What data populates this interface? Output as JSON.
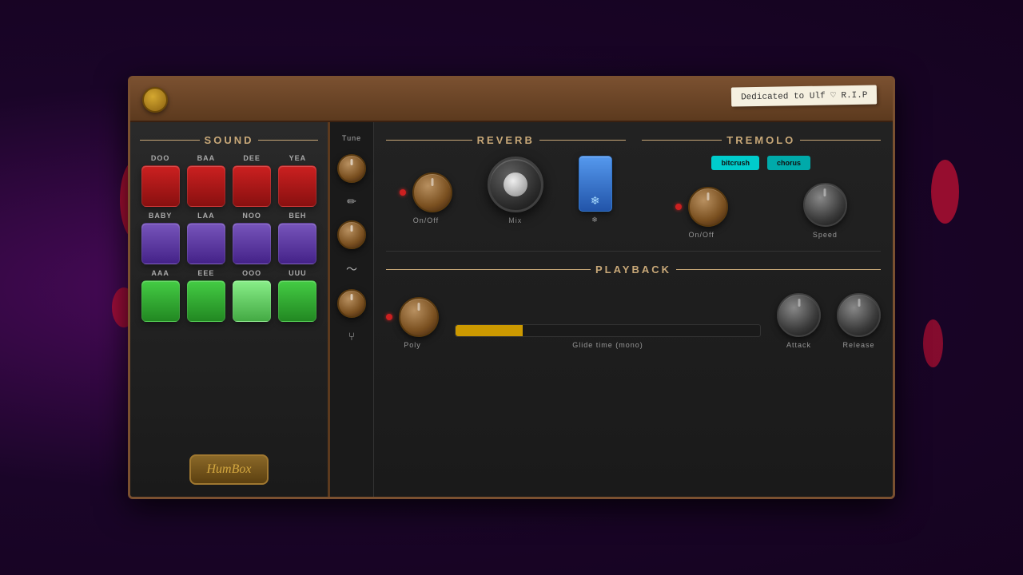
{
  "window": {
    "dedication": "Dedicated to Ulf ♡ R.I.P"
  },
  "sound_panel": {
    "title": "SOUND",
    "pads": [
      {
        "label": "DOO",
        "color": "red"
      },
      {
        "label": "BAA",
        "color": "red"
      },
      {
        "label": "DEE",
        "color": "red"
      },
      {
        "label": "YEA",
        "color": "red"
      },
      {
        "label": "BABY",
        "color": "purple"
      },
      {
        "label": "LAA",
        "color": "purple"
      },
      {
        "label": "NOO",
        "color": "purple"
      },
      {
        "label": "BEH",
        "color": "purple"
      },
      {
        "label": "AAA",
        "color": "green"
      },
      {
        "label": "EEE",
        "color": "green"
      },
      {
        "label": "OOO",
        "color": "green-light"
      },
      {
        "label": "UUU",
        "color": "green"
      }
    ],
    "logo": "HumBox"
  },
  "tune_strip": {
    "label": "Tune"
  },
  "reverb": {
    "title": "REVERB",
    "on_off_label": "On/Off",
    "mix_label": "Mix"
  },
  "tremolo": {
    "title": "TREMOLO",
    "on_off_label": "On/Off",
    "speed_label": "Speed",
    "bitcrush_label": "bitcrush",
    "chorus_label": "chorus"
  },
  "playback": {
    "title": "PLAYBACK",
    "poly_label": "Poly",
    "glide_label": "Glide time (mono)",
    "attack_label": "Attack",
    "release_label": "Release",
    "glide_percent": 22
  }
}
